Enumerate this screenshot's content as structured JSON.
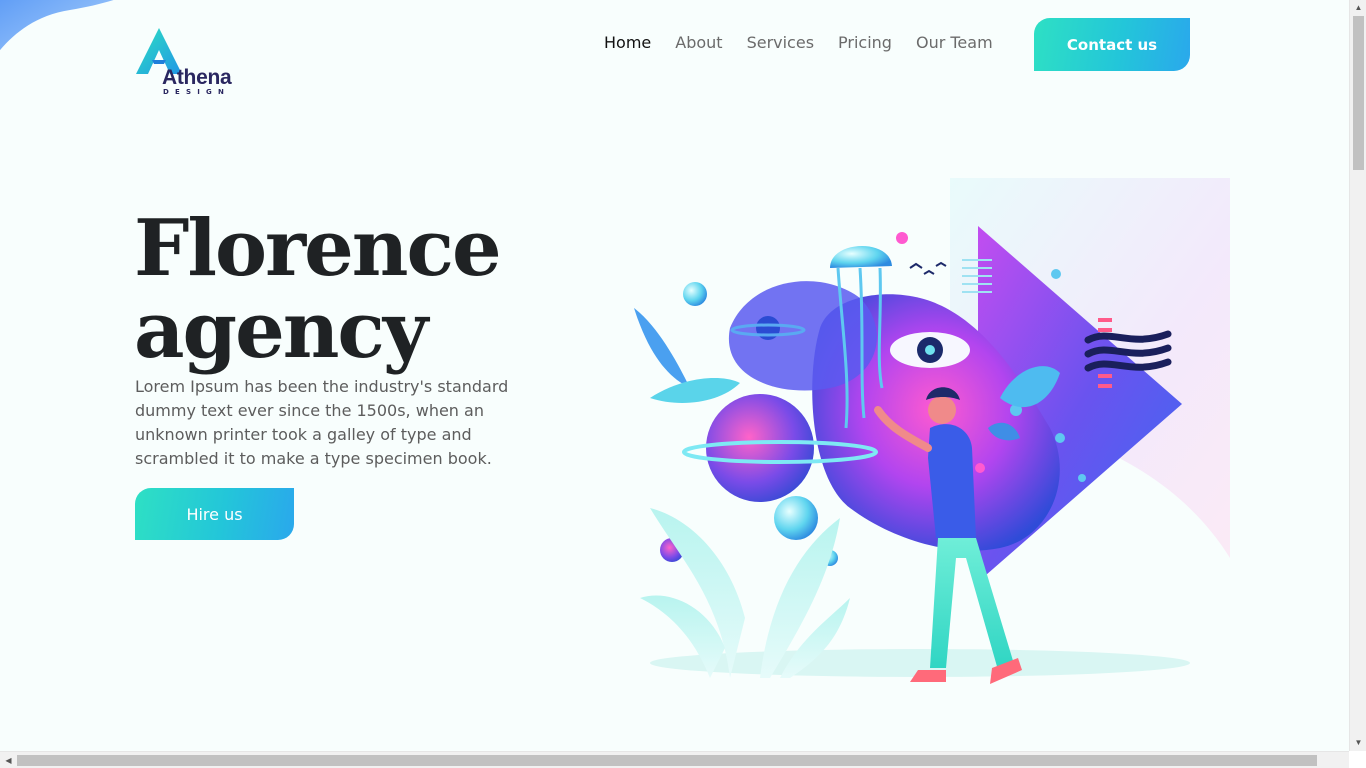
{
  "brand": {
    "name": "Athena",
    "tagline": "DESIGN",
    "logo_icon": "triangle-a-logo"
  },
  "nav": {
    "items": [
      {
        "label": "Home",
        "active": true
      },
      {
        "label": "About",
        "active": false
      },
      {
        "label": "Services",
        "active": false
      },
      {
        "label": "Pricing",
        "active": false
      },
      {
        "label": "Our Team",
        "active": false
      }
    ],
    "contact_label": "Contact us"
  },
  "hero": {
    "title_line1": "Florence",
    "title_line2": "agency",
    "description": "Lorem Ipsum has been the industry's standard dummy text ever since the 1500s, when an unknown printer took a galley of type and scrambled it to make a type specimen book.",
    "cta_label": "Hire us",
    "illustration": "surreal-space-illustration"
  },
  "colors": {
    "accent_start": "#2ee0c4",
    "accent_end": "#2aa8ec",
    "heading": "#1f2224",
    "brand_dark": "#2a2760"
  }
}
